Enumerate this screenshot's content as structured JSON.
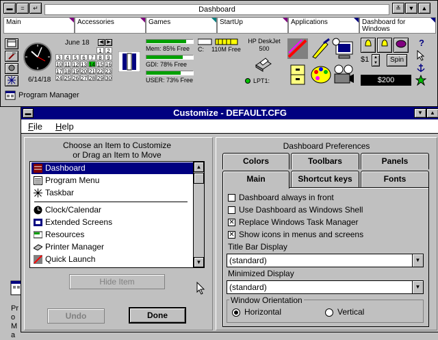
{
  "dashboard": {
    "title": "Dashboard",
    "tabs": [
      "Main",
      "Accessories",
      "Games",
      "StartUp",
      "Applications",
      "Dashboard for Windows"
    ],
    "calendar": {
      "month": "June 18",
      "days": [
        [
          "",
          "",
          "",
          "",
          "",
          "1",
          "2"
        ],
        [
          "3",
          "4",
          "5",
          "6",
          "7",
          "8",
          "9"
        ],
        [
          "10",
          "11",
          "12",
          "13",
          "14",
          "15",
          "16"
        ],
        [
          "17",
          "18",
          "19",
          "20",
          "21",
          "22",
          "23"
        ],
        [
          "24",
          "25",
          "26",
          "27",
          "28",
          "29",
          "30"
        ]
      ],
      "today": "14",
      "date": "6/14/18",
      "prev": "◀",
      "next": "▶"
    },
    "resources": {
      "mem": "Mem:  85% Free",
      "gdi": "GDI:   78% Free",
      "user": "USER:  73% Free",
      "mem_level": 0.85,
      "gdi_level": 0.78,
      "user_level": 0.73
    },
    "disk": {
      "drive": "C:",
      "free": "110M Free"
    },
    "printer": {
      "name": "HP DeskJet 500",
      "port": "LPT1:"
    },
    "money": {
      "bet": "$1",
      "spin": "Spin",
      "balance": "$200"
    },
    "program_manager": "Program Manager",
    "colors": {
      "title_bar": "#000080",
      "accent_flag": "#800080",
      "meter": "#00a000"
    }
  },
  "customize": {
    "title": "Customize - DEFAULT.CFG",
    "menu": {
      "file": "File",
      "help": "Help"
    },
    "choose_label_1": "Choose an Item to Customize",
    "choose_label_2": "or Drag an Item to Move",
    "items": [
      "Dashboard",
      "Program Menu",
      "Taskbar",
      "Clock/Calendar",
      "Extended Screens",
      "Resources",
      "Printer Manager",
      "Quick Launch"
    ],
    "hide_item": "Hide Item",
    "undo": "Undo",
    "done": "Done",
    "prefs_title": "Dashboard Preferences",
    "tabs_row1": [
      "Colors",
      "Toolbars",
      "Panels"
    ],
    "tabs_row2": [
      "Main",
      "Shortcut keys",
      "Fonts"
    ],
    "options": [
      {
        "label": "Dashboard always in front",
        "checked": false
      },
      {
        "label": "Use Dashboard as Windows Shell",
        "checked": false
      },
      {
        "label": "Replace Windows Task Manager",
        "checked": true
      },
      {
        "label": "Show icons in menus and screens",
        "checked": true
      }
    ],
    "title_bar_display_label": "Title Bar Display",
    "title_bar_display_value": "(standard)",
    "minimized_display_label": "Minimized Display",
    "minimized_display_value": "(standard)",
    "orientation_label": "Window Orientation",
    "horizontal": "Horizontal",
    "vertical": "Vertical",
    "selected_orientation": "Horizontal"
  },
  "desktop_icon_label": "Pro Ma"
}
